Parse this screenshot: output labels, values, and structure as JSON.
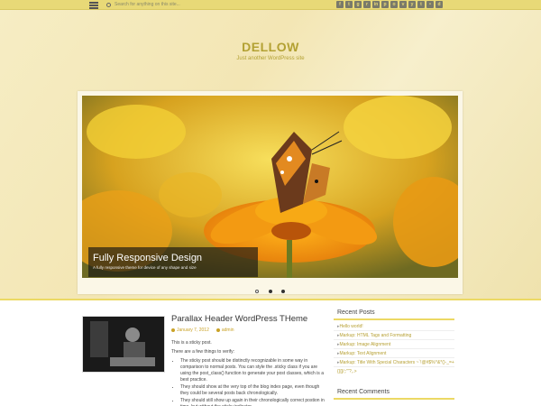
{
  "topbar": {
    "search_placeholder": "Search for anything on this site...",
    "social_icons": [
      "facebook-icon",
      "twitter-icon",
      "google-plus-icon",
      "rss-icon",
      "linkedin-icon",
      "pinterest-icon",
      "instagram-icon",
      "vimeo-icon",
      "youtube-icon",
      "tumblr-icon",
      "flickr-icon",
      "dribbble-icon"
    ]
  },
  "header": {
    "title": "DELLOW",
    "tagline": "Just another WordPress site"
  },
  "slider": {
    "caption_title": "Fully Responsive Design",
    "caption_subtitle": "A fully responsive theme for device of any shape and size",
    "dots": 3,
    "active_dot": 0
  },
  "post": {
    "title": "Parallax Header WordPress THeme",
    "date": "January 7, 2012",
    "author": "admin",
    "intro": "This is a sticky post.",
    "lead": "There are a few things to verify:",
    "items": [
      "The sticky post should be distinctly recognizable in some way in comparison to normal posts. You can style the .sticky class if you are using the post_class() function to generate your post classes, which is a best practice.",
      "They should show at the very top of the blog index page, even though they could be several posts back chronologically.",
      "They should still show up again in their chronologically correct postion in time, but without the sticky indicator."
    ]
  },
  "sidebar": {
    "recent_posts_title": "Recent Posts",
    "recent_posts": [
      "Hello world!",
      "Markup: HTML Tags and Formatting",
      "Markup: Image Alignment",
      "Markup: Text Alignment",
      "Markup: Title With Special Characters ~`!@#$%^&*()-_=+{}[]/;:'\"?,.>"
    ],
    "recent_comments_title": "Recent Comments"
  },
  "colors": {
    "accent": "#b3a133",
    "topbar": "#e8d977",
    "link": "#b7a033"
  }
}
